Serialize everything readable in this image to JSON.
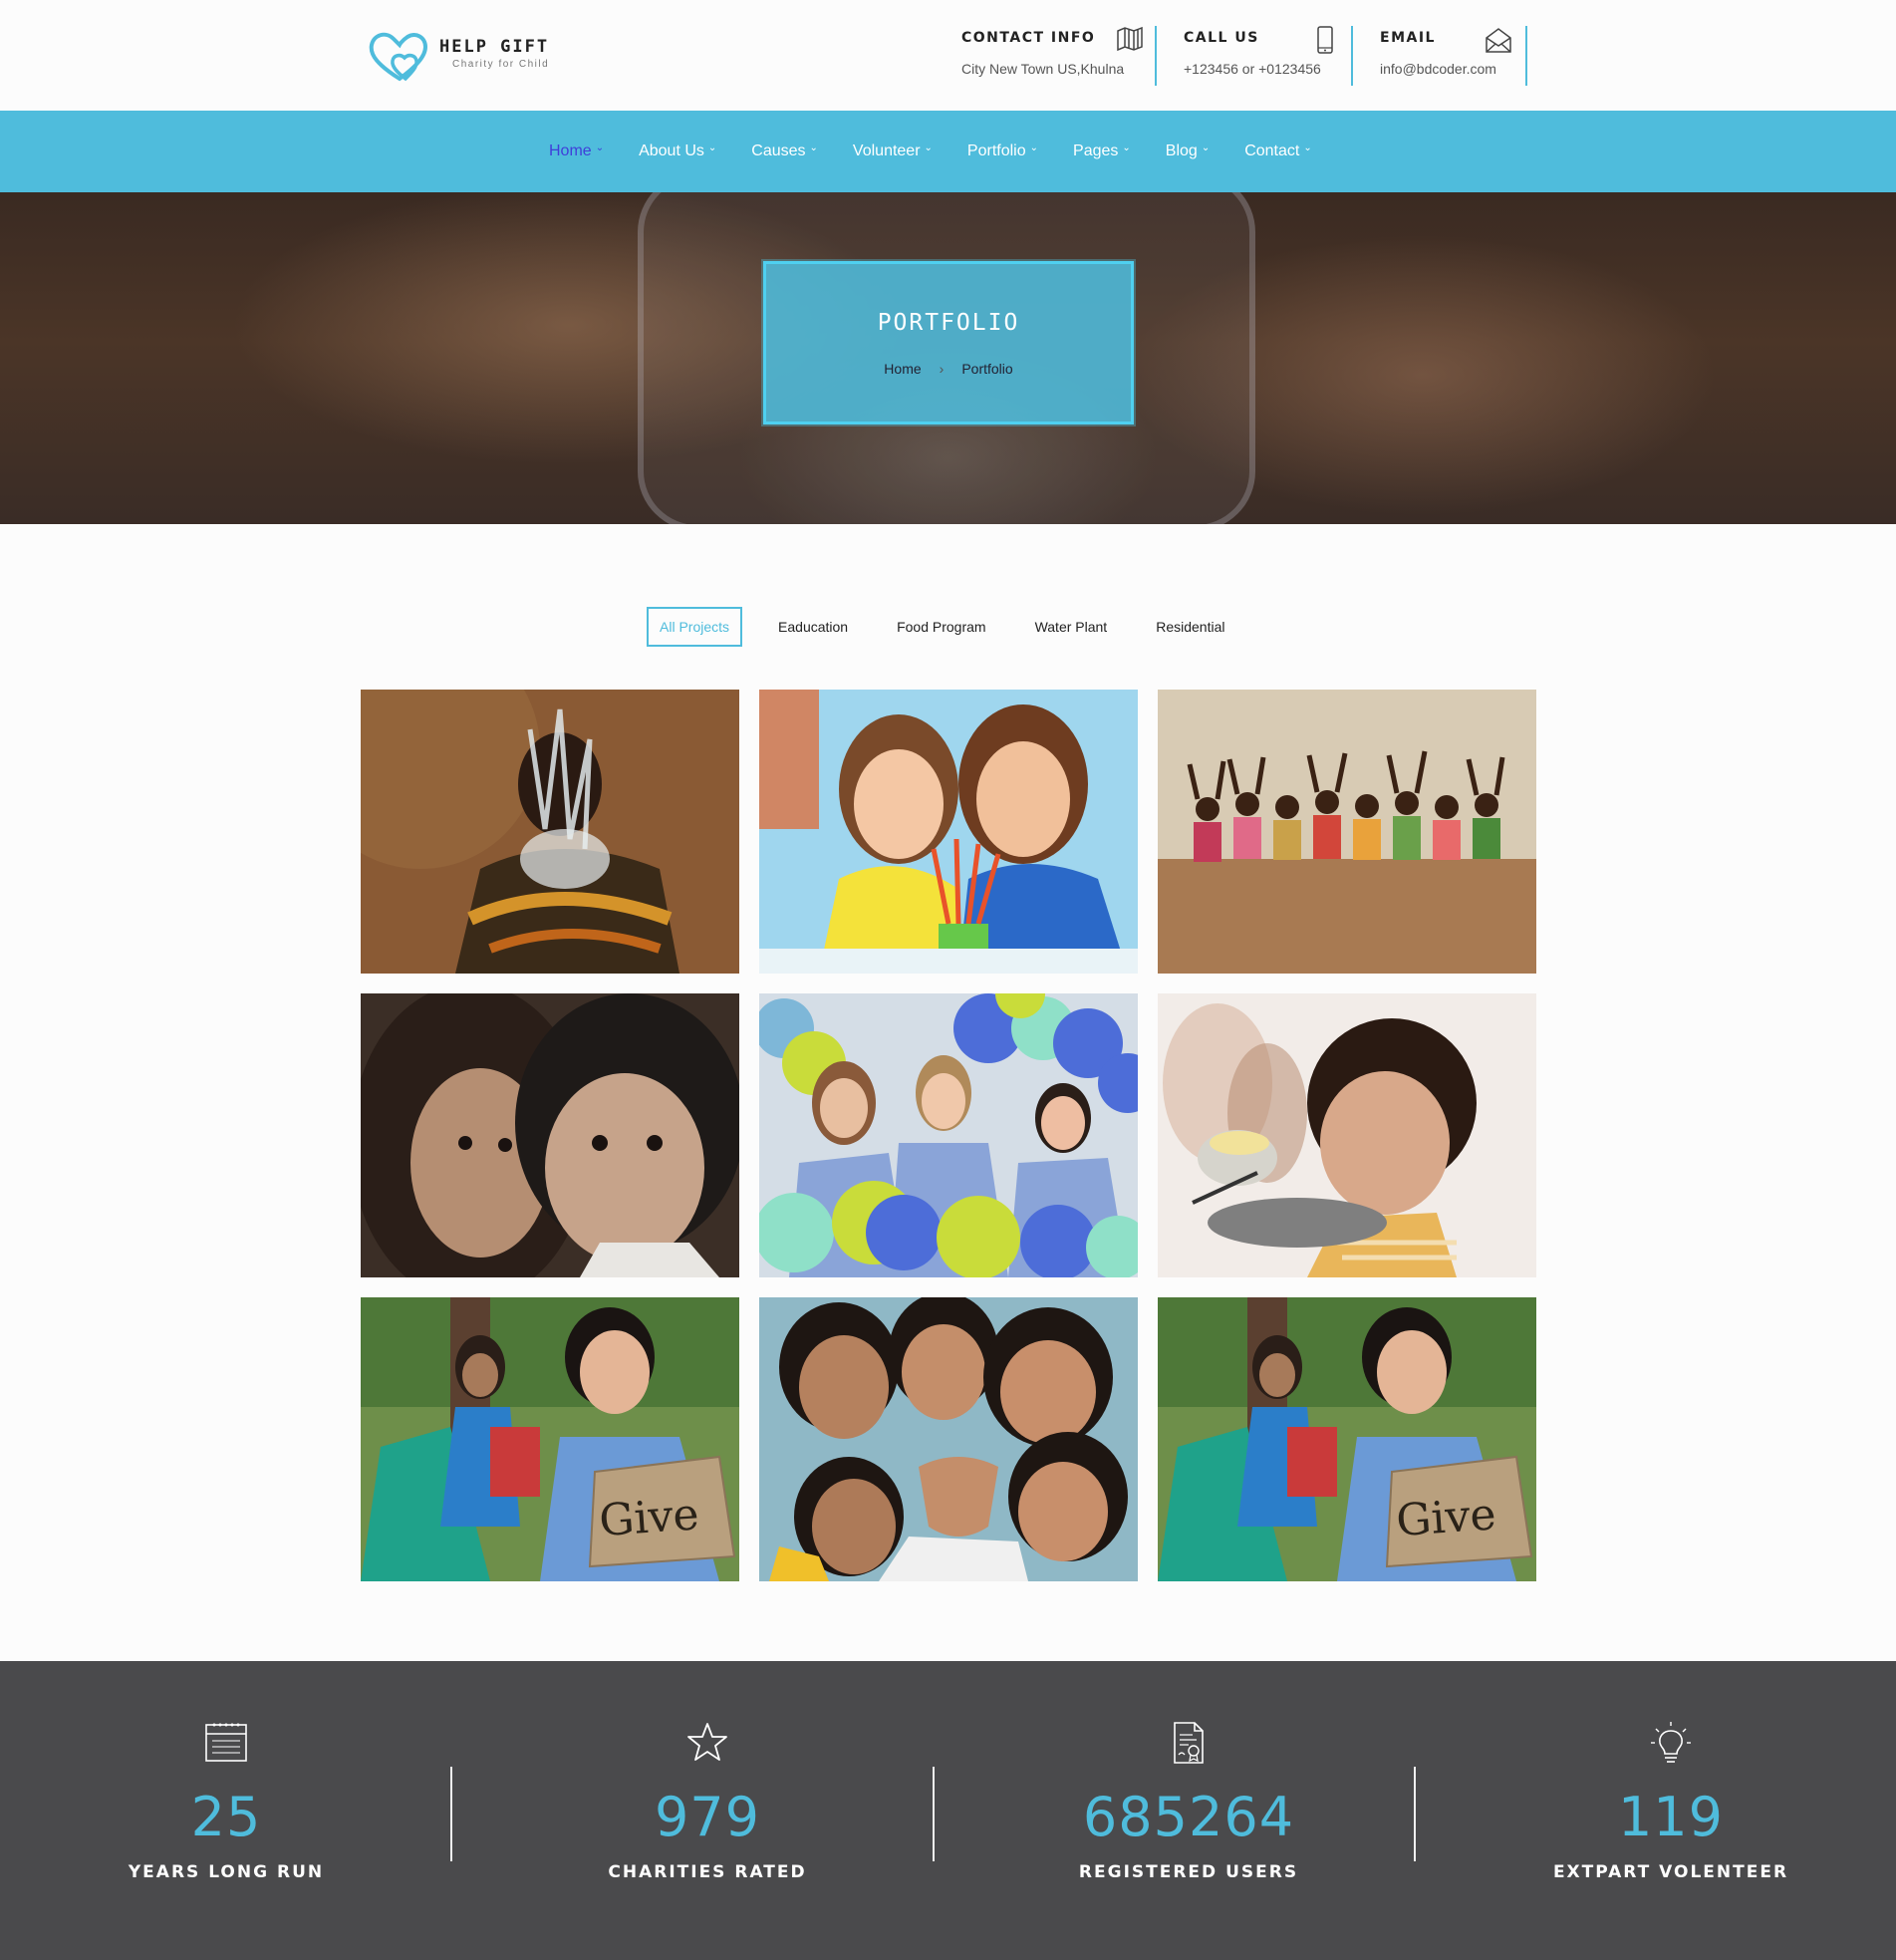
{
  "brand": {
    "name": "HELP GIFT",
    "tagline": "Charity for Child",
    "accent": "#4fbcdc"
  },
  "header_contacts": [
    {
      "label": "CONTACT INFO",
      "value": "City New Town US,Khulna",
      "icon": "map-icon"
    },
    {
      "label": "CALL US",
      "value": "+123456 or +0123456",
      "icon": "phone-icon"
    },
    {
      "label": "EMAIL",
      "value": "info@bdcoder.com",
      "icon": "envelope-icon"
    }
  ],
  "nav": [
    {
      "label": "Home",
      "active": true
    },
    {
      "label": "About Us"
    },
    {
      "label": "Causes"
    },
    {
      "label": "Volunteer"
    },
    {
      "label": "Portfolio"
    },
    {
      "label": "Pages"
    },
    {
      "label": "Blog"
    },
    {
      "label": "Contact"
    }
  ],
  "hero": {
    "title": "PORTFOLIO",
    "breadcrumb": [
      "Home",
      "Portfolio"
    ]
  },
  "filters": [
    "All Projects",
    "Eaducation",
    "Food Program",
    "Water Plant",
    "Residential"
  ],
  "filter_active": "All Projects",
  "portfolio": [
    {
      "subject": "boy-water-splash"
    },
    {
      "subject": "two-girls-classroom"
    },
    {
      "subject": "children-on-wall"
    },
    {
      "subject": "two-children-closeup"
    },
    {
      "subject": "volunteers-balloons"
    },
    {
      "subject": "boy-eating"
    },
    {
      "subject": "girl-give-sign",
      "sign_text": "Give"
    },
    {
      "subject": "happy-children-group"
    },
    {
      "subject": "girl-give-sign",
      "sign_text": "Give"
    }
  ],
  "stats": [
    {
      "value": "25",
      "label": "YEARS LONG RUN",
      "icon": "calendar-icon"
    },
    {
      "value": "979",
      "label": "CHARITIES RATED",
      "icon": "star-icon"
    },
    {
      "value": "685264",
      "label": "REGISTERED USERS",
      "icon": "certificate-icon"
    },
    {
      "value": "119",
      "label": "EXTPART VOLENTEER",
      "icon": "lightbulb-icon"
    }
  ]
}
